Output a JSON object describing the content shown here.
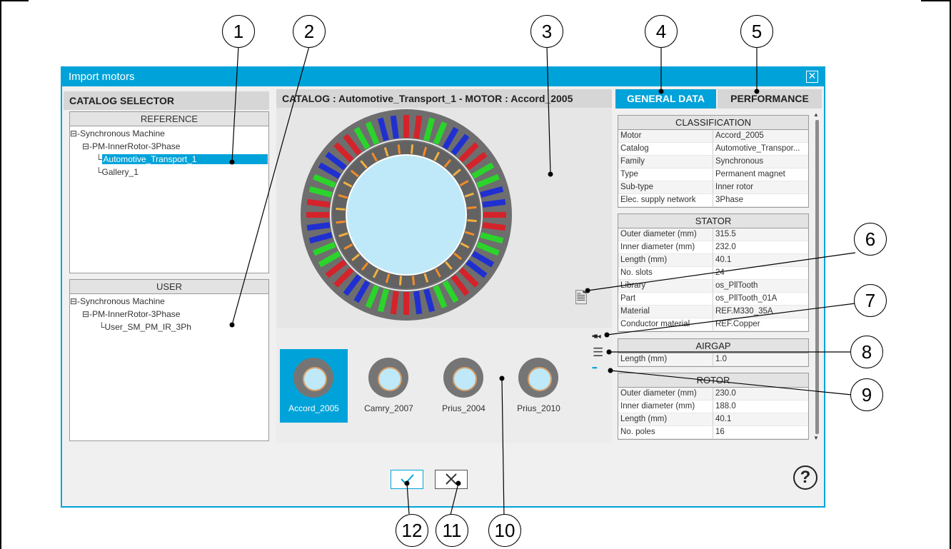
{
  "window": {
    "title": "Import motors"
  },
  "catalog_selector": {
    "header": "CATALOG SELECTOR",
    "reference": {
      "title": "REFERENCE",
      "items": [
        {
          "label": "Synchronous Machine",
          "prefix": "⊟-"
        },
        {
          "label": "PM-InnerRotor-3Phase",
          "prefix": "⊟-"
        },
        {
          "label": "Automotive_Transport_1",
          "prefix": "└",
          "selected": true
        },
        {
          "label": "Gallery_1",
          "prefix": "└"
        }
      ]
    },
    "user": {
      "title": "USER",
      "items": [
        {
          "label": "Synchronous Machine",
          "prefix": "⊟-"
        },
        {
          "label": "PM-InnerRotor-3Phase",
          "prefix": "⊟-"
        },
        {
          "label": "User_SM_PM_IR_3Ph",
          "prefix": "└"
        }
      ]
    }
  },
  "viewer": {
    "header": "CATALOG : Automotive_Transport_1   -   MOTOR : Accord_2005",
    "thumbnails": [
      {
        "label": "Accord_2005",
        "active": true
      },
      {
        "label": "Camry_2007",
        "active": false
      },
      {
        "label": "Prius_2004",
        "active": false
      },
      {
        "label": "Prius_2010",
        "active": false
      }
    ]
  },
  "tabs": [
    {
      "label": "GENERAL DATA",
      "active": true
    },
    {
      "label": "PERFORMANCE",
      "active": false
    }
  ],
  "properties": {
    "classification": {
      "title": "CLASSIFICATION",
      "rows": [
        [
          "Motor",
          "Accord_2005"
        ],
        [
          "Catalog",
          "Automotive_Transpor..."
        ],
        [
          "Family",
          "Synchronous"
        ],
        [
          "Type",
          "Permanent magnet"
        ],
        [
          "Sub-type",
          "Inner rotor"
        ],
        [
          "Elec. supply network",
          "3Phase"
        ]
      ]
    },
    "stator": {
      "title": "STATOR",
      "rows": [
        [
          "Outer diameter (mm)",
          "315.5"
        ],
        [
          "Inner diameter (mm)",
          "232.0"
        ],
        [
          "Length (mm)",
          "40.1"
        ],
        [
          "No. slots",
          "24"
        ],
        [
          "Library",
          "os_PllTooth"
        ],
        [
          "Part",
          "os_PllTooth_01A"
        ],
        [
          "Material",
          "REF.M330_35A"
        ],
        [
          "Conductor material",
          "REF.Copper"
        ]
      ]
    },
    "airgap": {
      "title": "AIRGAP",
      "rows": [
        [
          "Length (mm)",
          "1.0"
        ]
      ]
    },
    "rotor": {
      "title": "ROTOR",
      "rows": [
        [
          "Outer diameter (mm)",
          "230.0"
        ],
        [
          "Inner diameter (mm)",
          "188.0"
        ],
        [
          "Length (mm)",
          "40.1"
        ],
        [
          "No. poles",
          "16"
        ]
      ]
    }
  },
  "side_icons": [
    {
      "name": "document-icon",
      "glyph": "🗎"
    },
    {
      "name": "toggle-view-icon",
      "glyph": "▪■◂"
    },
    {
      "name": "list-view-icon",
      "glyph": "☰"
    },
    {
      "name": "grid-view-icon",
      "glyph": "▪▪▪"
    }
  ],
  "buttons": {
    "ok": "✓",
    "cancel": "✕",
    "help": "?"
  },
  "callouts": [
    "1",
    "2",
    "3",
    "4",
    "5",
    "6",
    "7",
    "8",
    "9",
    "10",
    "11",
    "12"
  ],
  "colors": {
    "accent": "#00a3d9",
    "stator": "#6e6e6e",
    "bore": "#bfe9f8"
  }
}
